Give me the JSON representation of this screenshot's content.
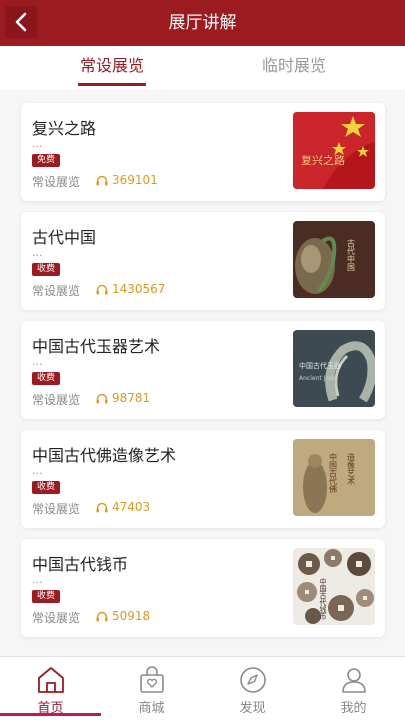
{
  "header": {
    "title": "展厅讲解"
  },
  "tabs": [
    {
      "label": "常设展览",
      "active": true
    },
    {
      "label": "临时展览",
      "active": false
    }
  ],
  "colors": {
    "brand": "#9b1b21",
    "accent_gold": "#d99a24"
  },
  "exhibits": [
    {
      "title": "复兴之路",
      "summary": "...",
      "badge": "免费",
      "type": "常设展览",
      "listen_count": "369101",
      "thumb_icon": "thumbnail-revival-road"
    },
    {
      "title": "古代中国",
      "summary": "...",
      "badge": "收费",
      "type": "常设展览",
      "listen_count": "1430567",
      "thumb_icon": "thumbnail-ancient-china"
    },
    {
      "title": "中国古代玉器艺术",
      "summary": "...",
      "badge": "收费",
      "type": "常设展览",
      "listen_count": "98781",
      "thumb_icon": "thumbnail-ancient-jade"
    },
    {
      "title": "中国古代佛造像艺术",
      "summary": "...",
      "badge": "收费",
      "type": "常设展览",
      "listen_count": "47403",
      "thumb_icon": "thumbnail-buddhist-statue"
    },
    {
      "title": "中国古代钱币",
      "summary": "...",
      "badge": "收费",
      "type": "常设展览",
      "listen_count": "50918",
      "thumb_icon": "thumbnail-ancient-coins"
    }
  ],
  "nav": [
    {
      "label": "首页",
      "icon": "home-icon",
      "active": true
    },
    {
      "label": "商城",
      "icon": "shopping-bag-icon",
      "active": false
    },
    {
      "label": "发现",
      "icon": "compass-icon",
      "active": false
    },
    {
      "label": "我的",
      "icon": "user-icon",
      "active": false
    }
  ]
}
